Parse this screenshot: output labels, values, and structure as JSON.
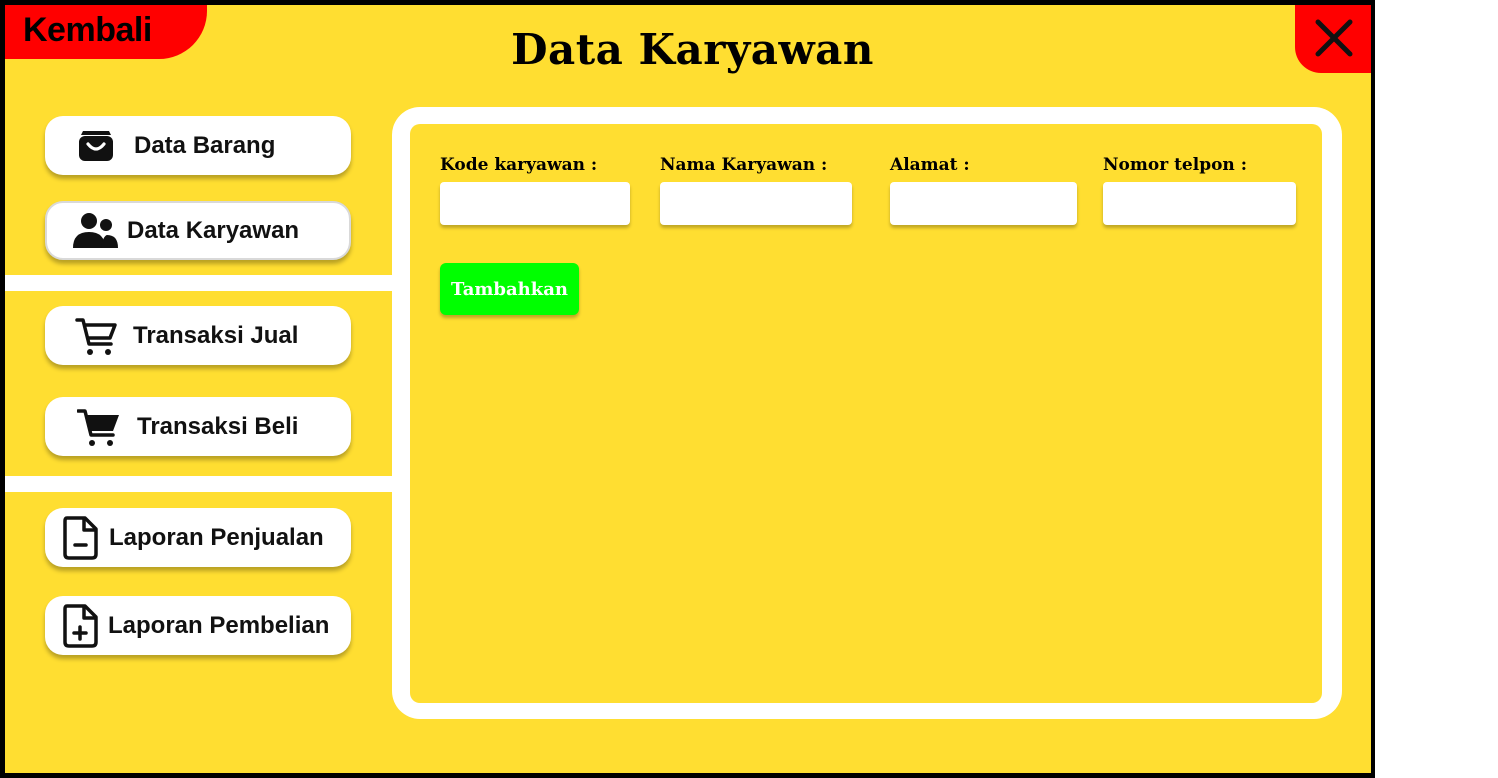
{
  "header": {
    "back_label": "Kembali",
    "title": "Data Karyawan"
  },
  "sidebar": {
    "items": [
      {
        "label": "Data Barang",
        "icon": "basket-icon"
      },
      {
        "label": "Data Karyawan",
        "icon": "users-icon"
      },
      {
        "label": "Transaksi Jual",
        "icon": "cart-outline-icon"
      },
      {
        "label": "Transaksi Beli",
        "icon": "cart-filled-icon"
      },
      {
        "label": "Laporan Penjualan",
        "icon": "file-minus-icon"
      },
      {
        "label": "Laporan Pembelian",
        "icon": "file-plus-icon"
      }
    ]
  },
  "form": {
    "fields": [
      {
        "label": "Kode karyawan :",
        "value": "",
        "placeholder": ""
      },
      {
        "label": "Nama  Karyawan  :",
        "value": "",
        "placeholder": ""
      },
      {
        "label": "Alamat  :",
        "value": "",
        "placeholder": ""
      },
      {
        "label": "Nomor telpon  :",
        "value": "",
        "placeholder": ""
      }
    ],
    "submit_label": "Tambahkan"
  },
  "colors": {
    "background": "#FFDE31",
    "accent_red": "#FF0000",
    "submit_green": "#00FF00",
    "panel_white": "#FFFFFF"
  }
}
